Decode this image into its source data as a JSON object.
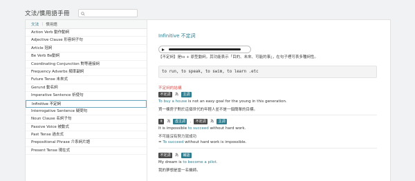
{
  "app": {
    "title": "文法/慣用語手冊",
    "search_placeholder": ""
  },
  "sidebar": {
    "tabs": [
      {
        "label": "文法"
      },
      {
        "label": "慣用語"
      }
    ],
    "items": [
      {
        "label": "Action Verb 動作動詞"
      },
      {
        "label": "Adjective Clause 形容詞子句"
      },
      {
        "label": "Article 冠詞"
      },
      {
        "label": "Be Verb Be動詞"
      },
      {
        "label": "Coordinating Conjunction 對等連接詞"
      },
      {
        "label": "Frequency Adverbs 頻率副詞"
      },
      {
        "label": "Future Tense 未來式"
      },
      {
        "label": "Gerund 動名詞"
      },
      {
        "label": "Imperative Sentence 祈使句"
      },
      {
        "label": "Infinitive 不定詞"
      },
      {
        "label": "Interrogative Sentence 疑問句"
      },
      {
        "label": "Noun Clause 名詞子句"
      },
      {
        "label": "Passive Voice 被動式"
      },
      {
        "label": "Past Tense 過去式"
      },
      {
        "label": "Prepositional Phrase 介系詞片語"
      },
      {
        "label": "Present Tense 現在式"
      }
    ],
    "active_index": 9
  },
  "content": {
    "heading": "Infinitive 不定詞",
    "audio_progress": 1.0,
    "description": "【不定詞】是to + 原型動詞，其功能表示「目的、未來、可能的事」，在句子裡可表多種詞性。",
    "code": "to run, to speak, to swim, to learn .etc",
    "section_title": "不定詞的結構",
    "examples": [
      {
        "tags": [
          "不定詞",
          "為",
          "主詞"
        ],
        "en_prefix": "",
        "en_highlight": "To buy a house",
        "en_suffix": " is not an easy goal for the young in this generation.",
        "cn": "買一棟房子對於這個世代的年輕人並不是一個簡單的目標。"
      },
      {
        "tags": [
          "It",
          "為",
          "虛主詞",
          ",",
          "不定詞",
          "為",
          "主詞"
        ],
        "en_prefix": "It is impossible ",
        "en_highlight": "to succeed",
        "en_suffix": " without hard work.",
        "cn": "不可能沒有努力就成功",
        "extra_prefix": "= ",
        "extra_highlight": "To succeed",
        "extra_suffix": " without hard work is impossible."
      },
      {
        "tags": [
          "不定詞",
          "為",
          "補語"
        ],
        "en_prefix": "My dream is ",
        "en_highlight": "to become a pilot.",
        "en_suffix": "",
        "cn": "我的夢想是當一名機師。"
      }
    ]
  }
}
